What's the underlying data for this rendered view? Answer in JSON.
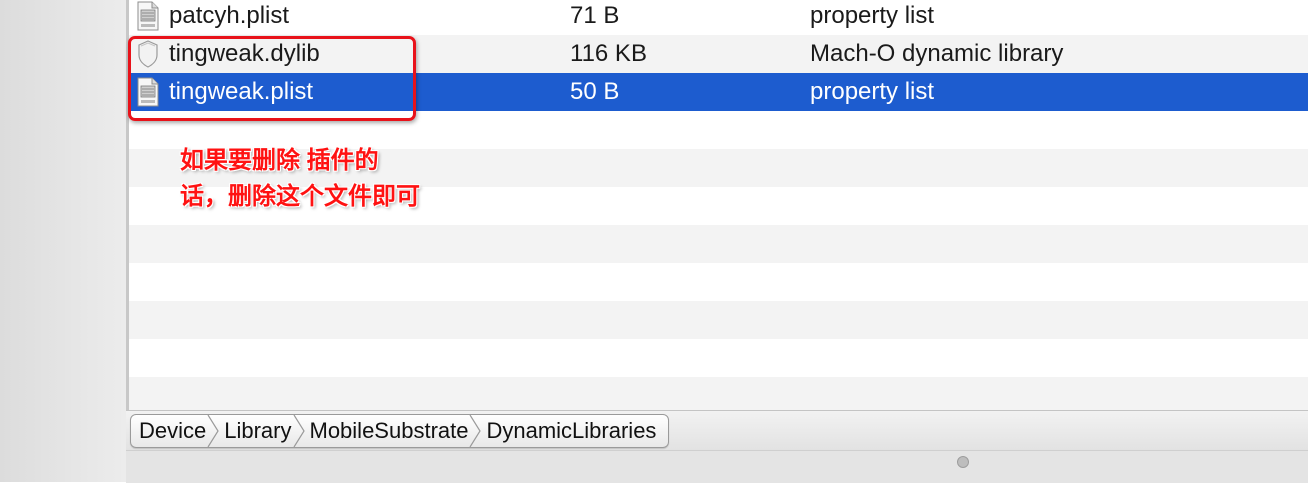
{
  "files": [
    {
      "name": "patcyh.plist",
      "size": "71 B",
      "kind": "property list",
      "icon": "plist-file-icon"
    },
    {
      "name": "tingweak.dylib",
      "size": "116 KB",
      "kind": "Mach-O dynamic library",
      "icon": "dylib-file-icon"
    },
    {
      "name": "tingweak.plist",
      "size": "50 B",
      "kind": "property list",
      "icon": "plist-file-icon",
      "selected": true
    }
  ],
  "annotation": {
    "line1": "如果要删除 插件的",
    "line2": "话，删除这个文件即可",
    "color": "#ff1212"
  },
  "path_bar": {
    "crumbs": [
      "Device",
      "Library",
      "MobileSubstrate",
      "DynamicLibraries"
    ]
  },
  "colors": {
    "selection": "#1d5ccf",
    "alt_row": "#f3f3f3"
  }
}
